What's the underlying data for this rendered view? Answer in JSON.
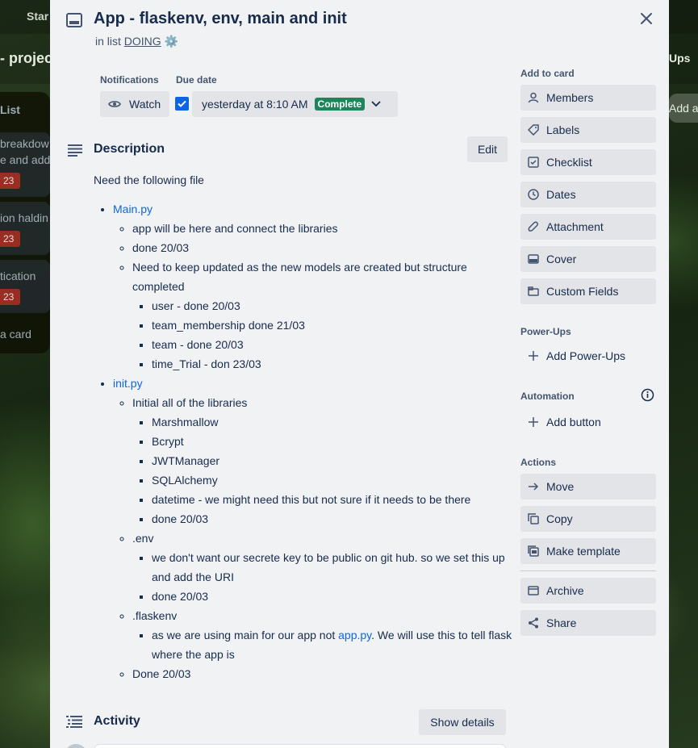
{
  "background": {
    "topbar_text": "Star",
    "board_title": "- projec",
    "list_title": "List",
    "cards": [
      {
        "text": "breakdow",
        "text2": "e and add",
        "badge": "23"
      },
      {
        "text": "ion haldin",
        "badge": "23"
      },
      {
        "text": "tication",
        "badge": "23"
      }
    ],
    "add_card": "a card",
    "right_text": "Ups",
    "right_text2": "Add an"
  },
  "card": {
    "title": "App - flaskenv, env, main and init",
    "in_list_prefix": "in list",
    "list_name": "DOING",
    "list_emoji": "⚙️"
  },
  "notifications": {
    "label": "Notifications",
    "watch_label": "Watch"
  },
  "due_date": {
    "label": "Due date",
    "value": "yesterday at 8:10 AM",
    "status": "Complete"
  },
  "description": {
    "title": "Description",
    "edit_label": "Edit",
    "intro": "Need the following file",
    "main_link": "Main.py",
    "main_items": [
      "app will be here and connect the libraries",
      "done 20/03",
      "Need to keep updated as the new models are created but structure completed"
    ],
    "main_sub_items": [
      "user - done 20/03",
      "team_membership done 21/03",
      "team - done 20/03",
      "time_Trial - don 23/03"
    ],
    "init_link": "init.py",
    "init_item": "Initial all of the libraries",
    "init_sub_items": [
      "Marshmallow",
      "Bcrypt",
      "JWTManager",
      "SQLAlchemy",
      "datetime - we might need this but not sure if it needs to be there",
      "done 20/03"
    ],
    "env_item": ".env",
    "env_sub_items": [
      "we don't want our secrete key to be public on git hub. so we set this up and add the URI",
      "done 20/03"
    ],
    "flaskenv_item": ".flaskenv",
    "flaskenv_text_before": "as we are using main for our app not ",
    "flaskenv_link": "app.py",
    "flaskenv_text_after": ". We will use this to tell flask where the app is",
    "done_item": "Done 20/03"
  },
  "activity": {
    "title": "Activity",
    "show_details_label": "Show details"
  },
  "sidebar": {
    "add_to_card_label": "Add to card",
    "add_to_card": [
      {
        "label": "Members",
        "icon": "person-icon"
      },
      {
        "label": "Labels",
        "icon": "tag-icon"
      },
      {
        "label": "Checklist",
        "icon": "checklist-icon"
      },
      {
        "label": "Dates",
        "icon": "clock-icon"
      },
      {
        "label": "Attachment",
        "icon": "paperclip-icon"
      },
      {
        "label": "Cover",
        "icon": "cover-icon"
      },
      {
        "label": "Custom Fields",
        "icon": "custom-fields-icon"
      }
    ],
    "powerups_label": "Power-Ups",
    "add_powerups": "Add Power-Ups",
    "automation_label": "Automation",
    "add_button": "Add button",
    "actions_label": "Actions",
    "actions": [
      {
        "label": "Move",
        "icon": "arrow-right-icon"
      },
      {
        "label": "Copy",
        "icon": "copy-icon"
      },
      {
        "label": "Make template",
        "icon": "template-icon"
      },
      {
        "label": "Archive",
        "icon": "archive-icon"
      },
      {
        "label": "Share",
        "icon": "share-icon"
      }
    ]
  },
  "colors": {
    "primary": "#0c66e4",
    "complete_badge": "#1f845a",
    "button_bg": "#e2e4e8",
    "modal_bg": "#f1f2f4"
  }
}
